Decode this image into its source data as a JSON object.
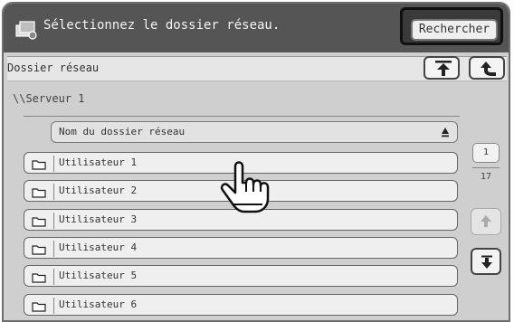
{
  "title": "Sélectionnez le dossier réseau.",
  "search_button": "Rechercher",
  "path_label": "Dossier réseau",
  "server_path": "\\\\Serveur 1",
  "column_header": "Nom du dossier réseau",
  "folders": [
    {
      "label": "Utilisateur 1"
    },
    {
      "label": "Utilisateur 2"
    },
    {
      "label": "Utilisateur 3"
    },
    {
      "label": "Utilisateur 4"
    },
    {
      "label": "Utilisateur 5"
    },
    {
      "label": "Utilisateur 6"
    }
  ],
  "pagination": {
    "current": "1",
    "total": "17"
  },
  "icons": {
    "title": "folder-network-icon",
    "nav_top": "go-to-top-icon",
    "nav_up": "go-up-icon",
    "sort": "sort-ascending-icon",
    "folder": "folder-icon",
    "scroll_up": "arrow-up-icon",
    "scroll_down": "arrow-down-icon",
    "pointer": "hand-pointer-icon"
  },
  "colors": {
    "titlebar": "#555555",
    "panel": "#cfcfcf",
    "button": "#efefef"
  }
}
